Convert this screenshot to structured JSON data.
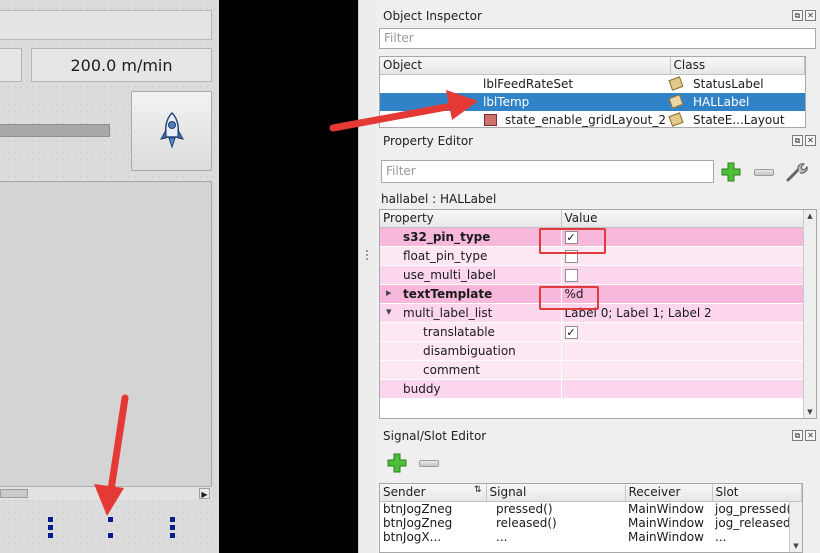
{
  "canvas": {
    "feed_readout": "200.0 m/min",
    "rocket_icon": "rocket-icon"
  },
  "object_inspector": {
    "title": "Object Inspector",
    "filter_placeholder": "Filter",
    "columns": [
      "Object",
      "Class"
    ],
    "rows": [
      {
        "object": "lblFeedRateSet",
        "class": "StatusLabel",
        "selected": false
      },
      {
        "object": "lblTemp",
        "class": "HALLabel",
        "selected": true
      },
      {
        "object": "state_enable_gridLayout_2",
        "class": "StateE...Layout",
        "selected": false
      }
    ]
  },
  "property_editor": {
    "title": "Property Editor",
    "filter_placeholder": "Filter",
    "object_label": "hallabel : HALLabel",
    "columns": [
      "Property",
      "Value"
    ],
    "rows": [
      {
        "name": "s32_pin_type",
        "bold": true,
        "value": "",
        "checkbox": true,
        "checked": true,
        "indent": 1,
        "expander": ""
      },
      {
        "name": "float_pin_type",
        "bold": false,
        "value": "",
        "checkbox": true,
        "checked": false,
        "indent": 1,
        "expander": ""
      },
      {
        "name": "use_multi_label",
        "bold": false,
        "value": "",
        "checkbox": true,
        "checked": false,
        "indent": 1,
        "expander": ""
      },
      {
        "name": "textTemplate",
        "bold": true,
        "value": "%d",
        "checkbox": false,
        "checked": false,
        "indent": 1,
        "expander": "collapsed"
      },
      {
        "name": "multi_label_list",
        "bold": false,
        "value": "Label 0; Label 1; Label 2",
        "checkbox": false,
        "checked": false,
        "indent": 1,
        "expander": "expanded"
      },
      {
        "name": "translatable",
        "bold": false,
        "value": "",
        "checkbox": true,
        "checked": true,
        "indent": 2,
        "expander": ""
      },
      {
        "name": "disambiguation",
        "bold": false,
        "value": "",
        "checkbox": false,
        "checked": false,
        "indent": 2,
        "expander": ""
      },
      {
        "name": "comment",
        "bold": false,
        "value": "",
        "checkbox": false,
        "checked": false,
        "indent": 2,
        "expander": ""
      },
      {
        "name": "buddy",
        "bold": false,
        "value": "",
        "checkbox": false,
        "checked": false,
        "indent": 1,
        "expander": ""
      }
    ]
  },
  "signal_slot_editor": {
    "title": "Signal/Slot Editor",
    "columns": [
      "Sender",
      "Signal",
      "Receiver",
      "Slot"
    ],
    "rows": [
      {
        "sender": "btnJogZneg",
        "signal": "pressed()",
        "receiver": "MainWindow",
        "slot": "jog_pressed()"
      },
      {
        "sender": "btnJogZneg",
        "signal": "released()",
        "receiver": "MainWindow",
        "slot": "jog_released()"
      },
      {
        "sender": "btnJogX...",
        "signal": "...",
        "receiver": "MainWindow",
        "slot": "..."
      }
    ]
  },
  "colors": {
    "selection": "#3183c8",
    "annotation_red": "#e53935",
    "pink_changed": "#f7b8dc",
    "pink_light": "#fbd6ec"
  }
}
